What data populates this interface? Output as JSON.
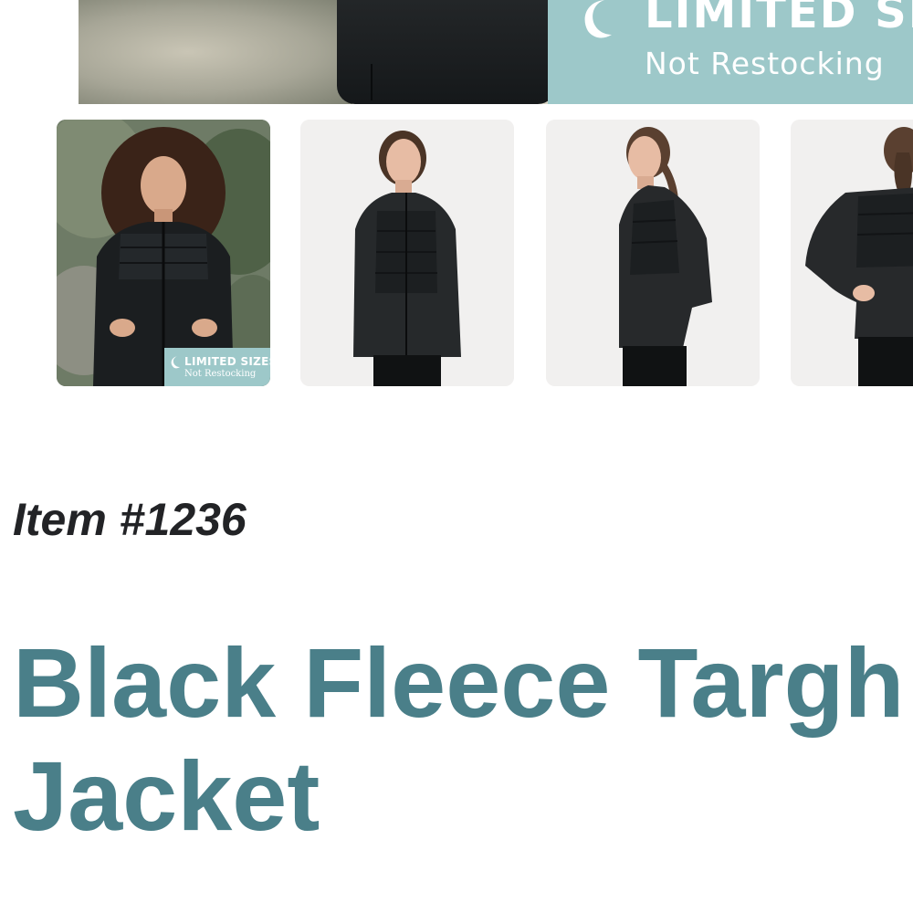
{
  "hero": {
    "banner_title": "LIMITED SIZES",
    "banner_subtitle": "Not Restocking",
    "banner_color": "#9dc8c9"
  },
  "thumbnails": [
    {
      "badge_title": "LIMITED SIZES",
      "badge_subtitle": "Not Restocking"
    },
    {},
    {},
    {}
  ],
  "product": {
    "item_number": "Item #1236",
    "title_line1": "Black Fleece Targh",
    "title_line2": "Jacket",
    "title_color": "#4a7f89"
  }
}
